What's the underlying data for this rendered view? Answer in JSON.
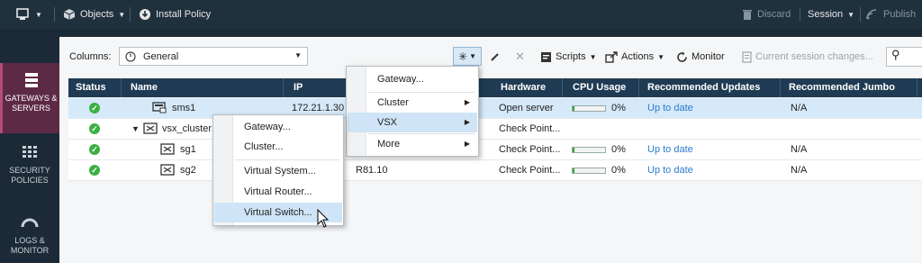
{
  "topbar": {
    "objects_label": "Objects",
    "install_policy_label": "Install Policy",
    "discard_label": "Discard",
    "session_label": "Session",
    "publish_label": "Publish"
  },
  "nav": {
    "items": [
      {
        "label": "GATEWAYS & SERVERS",
        "icon": "gateways-icon",
        "active": true
      },
      {
        "label": "SECURITY POLICIES",
        "icon": "policy-grid-icon",
        "active": false
      },
      {
        "label": "LOGS & MONITOR",
        "icon": "gauge-icon",
        "active": false
      }
    ]
  },
  "toolbar": {
    "columns_label": "Columns:",
    "columns_value": "General",
    "scripts_label": "Scripts",
    "actions_label": "Actions",
    "monitor_label": "Monitor",
    "session_changes_label": "Current session changes..."
  },
  "table": {
    "columns": [
      "Status",
      "Name",
      "IP",
      "Hardware",
      "CPU Usage",
      "Recommended Updates",
      "Recommended Jumbo"
    ],
    "rows": [
      {
        "name": "sms1",
        "ip": "172.21.1.30",
        "version": "",
        "hardware": "Open server",
        "cpu": "0%",
        "cpu_level": 0.05,
        "updates": "Up to date",
        "jumbo": "N/A",
        "selected": true
      },
      {
        "name": "vsx_cluster1",
        "ip": "",
        "version": "",
        "hardware": "Check Point...",
        "cpu": "",
        "cpu_level": null,
        "updates": "",
        "jumbo": "",
        "selected": false
      },
      {
        "name": "sg1",
        "ip": "",
        "version": "",
        "hardware": "Check Point...",
        "cpu": "0%",
        "cpu_level": 0.05,
        "updates": "Up to date",
        "jumbo": "N/A",
        "selected": false
      },
      {
        "name": "sg2",
        "ip": "",
        "version": "R81.10",
        "hardware": "Check Point...",
        "cpu": "0%",
        "cpu_level": 0.05,
        "updates": "Up to date",
        "jumbo": "N/A",
        "selected": false
      }
    ]
  },
  "new_menu": {
    "items": [
      "Gateway...",
      "Cluster",
      "VSX",
      "More"
    ]
  },
  "vsx_submenu": {
    "items": [
      "Gateway...",
      "Cluster...",
      "Virtual System...",
      "Virtual Router...",
      "Virtual Switch..."
    ]
  },
  "colors": {
    "accent": "#5c2a45",
    "header": "#1f3b53",
    "ok": "#3cb043",
    "link": "#2b7bd0",
    "highlight": "#cfe5f7"
  }
}
